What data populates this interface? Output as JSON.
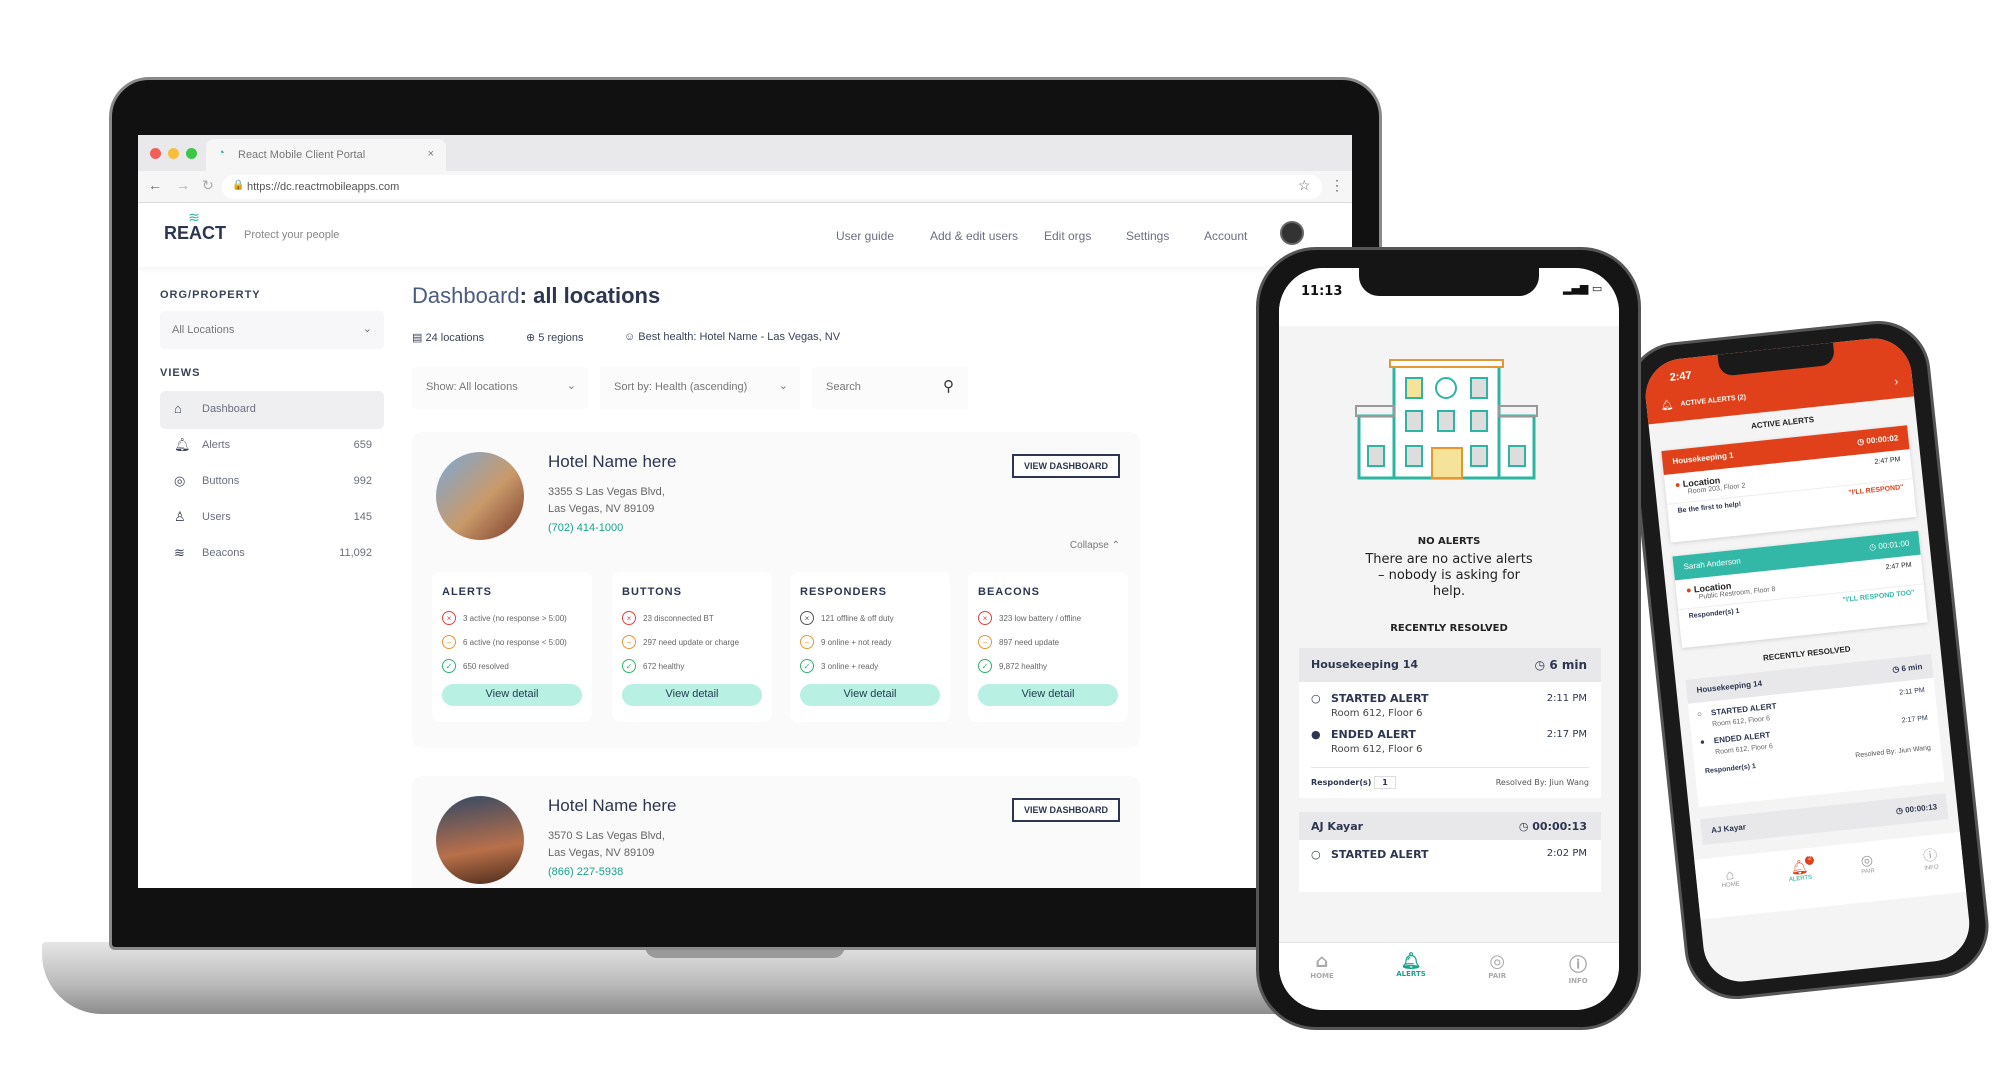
{
  "browser": {
    "tab_title": "React Mobile Client Portal",
    "url": "https://dc.reactmobileapps.com"
  },
  "header": {
    "logo": "REACT",
    "tagline": "Protect your people",
    "nav": [
      "User guide",
      "Add & edit users",
      "Edit orgs",
      "Settings",
      "Account"
    ]
  },
  "sidebar": {
    "org_heading": "ORG/PROPERTY",
    "org_select": "All Locations",
    "views_heading": "VIEWS",
    "items": [
      {
        "label": "Dashboard",
        "count": "",
        "icon": "home-icon"
      },
      {
        "label": "Alerts",
        "count": "659",
        "icon": "bell-icon"
      },
      {
        "label": "Buttons",
        "count": "992",
        "icon": "button-icon"
      },
      {
        "label": "Users",
        "count": "145",
        "icon": "user-icon"
      },
      {
        "label": "Beacons",
        "count": "11,092",
        "icon": "wifi-icon"
      }
    ]
  },
  "main": {
    "title_bold": "Dashboard",
    "title_rest": ": all locations",
    "stats": {
      "locations": "24 locations",
      "regions": "5 regions",
      "best": "Best health: Hotel Name - Las Vegas, NV"
    },
    "show_select": "Show: All locations",
    "sort_select": "Sort by: Health (ascending)",
    "search_placeholder": "Search",
    "hotels": [
      {
        "name": "Hotel Name here",
        "addr1": "3355 S Las Vegas Blvd,",
        "addr2": "Las Vegas, NV 89109",
        "phone": "(702) 414-1000",
        "button": "VIEW DASHBOARD",
        "collapse": "Collapse",
        "panels": [
          {
            "title": "ALERTS",
            "rows": [
              "3 active (no response > 5:00)",
              "6 active (no response < 5:00)",
              "650 resolved"
            ],
            "button": "View detail"
          },
          {
            "title": "BUTTONS",
            "rows": [
              "23 disconnected BT",
              "297 need update or charge",
              "672 healthy"
            ],
            "button": "View detail"
          },
          {
            "title": "RESPONDERS",
            "rows": [
              "121 offline & off duty",
              "9 online + not ready",
              "3 online + ready"
            ],
            "button": "View detail"
          },
          {
            "title": "BEACONS",
            "rows": [
              "323 low battery / offline",
              "897 need update",
              "9,872 healthy"
            ],
            "button": "View detail"
          }
        ]
      },
      {
        "name": "Hotel Name here",
        "addr1": "3570 S Las Vegas Blvd,",
        "addr2": "Las Vegas, NV 89109",
        "phone": "(866) 227-5938",
        "button": "VIEW DASHBOARD"
      }
    ]
  },
  "phone1": {
    "time": "11:13",
    "no_alerts": "NO ALERTS",
    "message": "There are no active alerts – nobody is asking for help.",
    "recent": "RECENTLY RESOLVED",
    "card1": {
      "name": "Housekeeping 14",
      "duration": "6 min",
      "started": "STARTED ALERT",
      "started_time": "2:11 PM",
      "started_loc": "Room 612, Floor 6",
      "ended": "ENDED ALERT",
      "ended_time": "2:17 PM",
      "ended_loc": "Room 612, Floor 6",
      "responders_label": "Responder(s)",
      "responders": "1",
      "resolved": "Resolved By: Jiun Wang"
    },
    "card2": {
      "name": "AJ Kayar",
      "duration": "00:00:13",
      "started": "STARTED ALERT",
      "started_time": "2:02 PM"
    },
    "tabs": [
      "HOME",
      "ALERTS",
      "PAIR",
      "INFO"
    ]
  },
  "phone2": {
    "time": "2:47",
    "banner": "ACTIVE ALERTS (2)",
    "heading": "ACTIVE ALERTS",
    "alert1": {
      "name": "Housekeeping 1",
      "timer": "00:00:02",
      "loc": "Location",
      "time": "2:47 PM",
      "detail": "Room 203, Floor 2",
      "prompt": "Be the first to help!",
      "action": "\"I'LL RESPOND\""
    },
    "alert2": {
      "name": "Sarah Anderson",
      "timer": "00:01:00",
      "loc": "Location",
      "time": "2:47 PM",
      "detail": "Public Restroom, Floor 8",
      "responders_label": "Responder(s)",
      "responders": "1",
      "action": "\"I'LL RESPOND TOO\""
    },
    "recent": "RECENTLY RESOLVED",
    "card1": {
      "name": "Housekeeping 14",
      "duration": "6 min",
      "started": "STARTED ALERT",
      "started_time": "2:11 PM",
      "started_loc": "Room 612, Floor 6",
      "ended": "ENDED ALERT",
      "ended_time": "2:17 PM",
      "ended_loc": "Room 612, Floor 6",
      "responders_label": "Responder(s)",
      "responders": "1",
      "resolved": "Resolved By: Jiun Wang"
    },
    "card2": {
      "name": "AJ Kayar",
      "duration": "00:00:13"
    },
    "tabs": [
      "HOME",
      "ALERTS",
      "PAIR",
      "INFO"
    ],
    "badge": "2"
  },
  "colors": {
    "accent": "#17a58a",
    "alert_red": "#e0401a",
    "teal": "#33b8a8",
    "navy": "#2d3650"
  }
}
